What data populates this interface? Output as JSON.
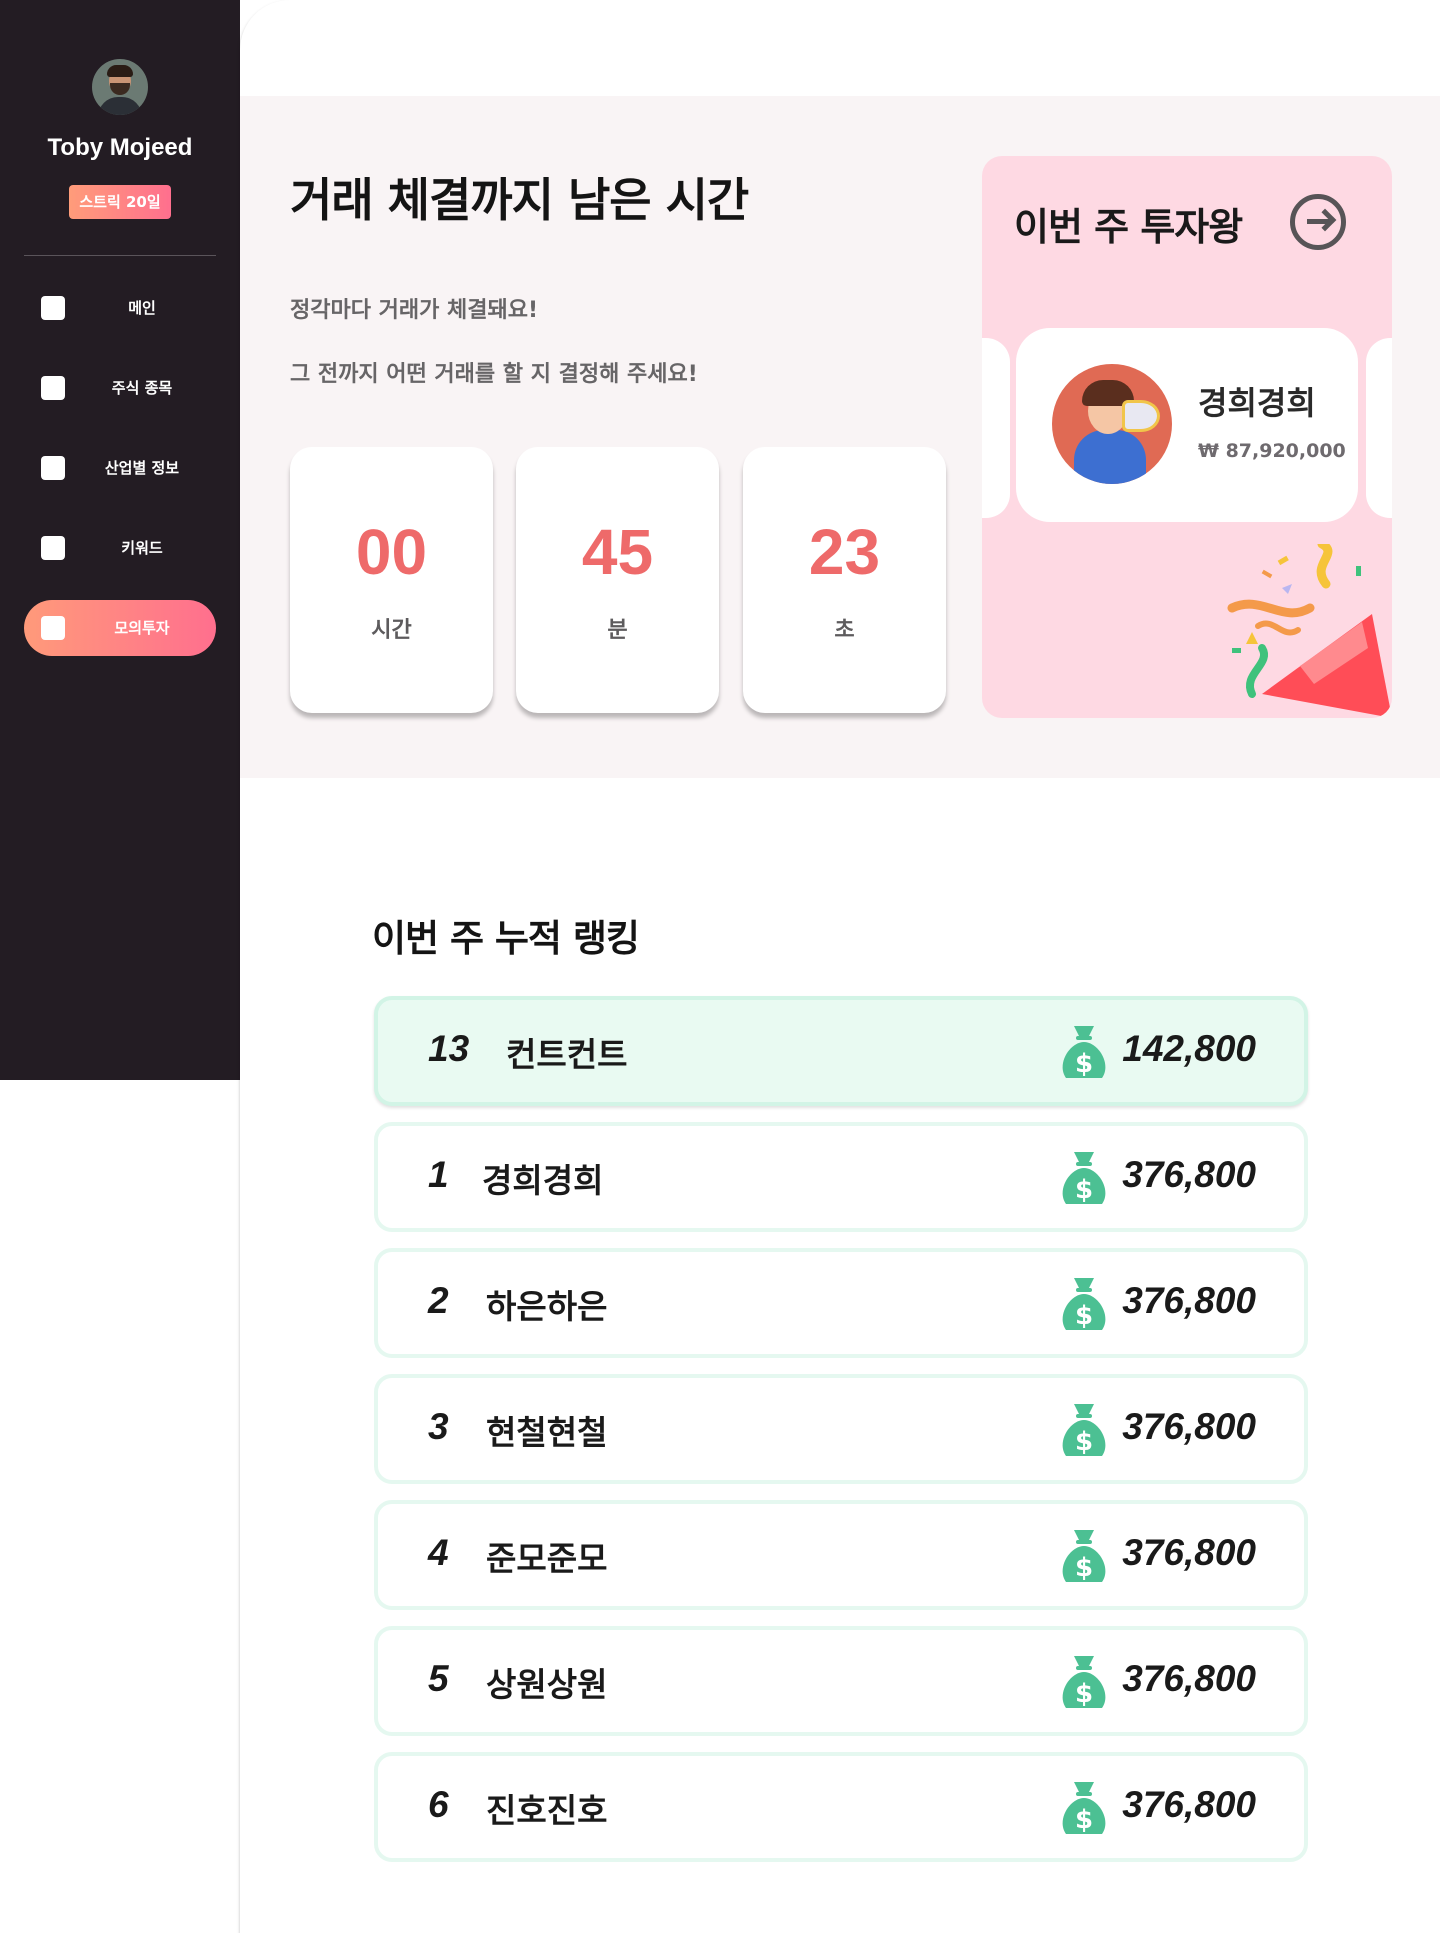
{
  "user": {
    "name": "Toby Mojeed",
    "streak": "스트릭 20일"
  },
  "nav": [
    {
      "label": "메인",
      "active": false
    },
    {
      "label": "주식 종목",
      "active": false
    },
    {
      "label": "산업별 정보",
      "active": false
    },
    {
      "label": "키워드",
      "active": false
    },
    {
      "label": "모의투자",
      "active": true
    }
  ],
  "hero": {
    "title": "거래 체결까지 남은 시간",
    "sub1": "정각마다 거래가 체결돼요!",
    "sub2": "그 전까지 어떤 거래를 할 지 결정해 주세요!",
    "timer": [
      {
        "value": "00",
        "unit": "시간"
      },
      {
        "value": "45",
        "unit": "분"
      },
      {
        "value": "23",
        "unit": "초"
      }
    ]
  },
  "winner": {
    "title": "이번 주 투자왕",
    "name": "경희경희",
    "amount": "₩ 87,920,000",
    "arrow_icon": "arrow-right-circle-icon"
  },
  "ranking": {
    "title": "이번 주 누적 랭킹",
    "me": {
      "rank": "13",
      "name": "컨트컨트",
      "score": "142,800"
    },
    "rows": [
      {
        "rank": "1",
        "name": "경희경희",
        "score": "376,800"
      },
      {
        "rank": "2",
        "name": "하은하은",
        "score": "376,800"
      },
      {
        "rank": "3",
        "name": "현철현철",
        "score": "376,800"
      },
      {
        "rank": "4",
        "name": "준모준모",
        "score": "376,800"
      },
      {
        "rank": "5",
        "name": "상원상원",
        "score": "376,800"
      },
      {
        "rank": "6",
        "name": "진호진호",
        "score": "376,800"
      }
    ]
  },
  "colors": {
    "sidebar": "#231c23",
    "accent_gradient_start": "#ff9a7a",
    "accent_gradient_end": "#ff6f8e",
    "timer_number": "#ee6a6a",
    "winner_panel": "#fed9e3",
    "money_bag": "#4cc093",
    "row_border": "#e5f8f0"
  }
}
